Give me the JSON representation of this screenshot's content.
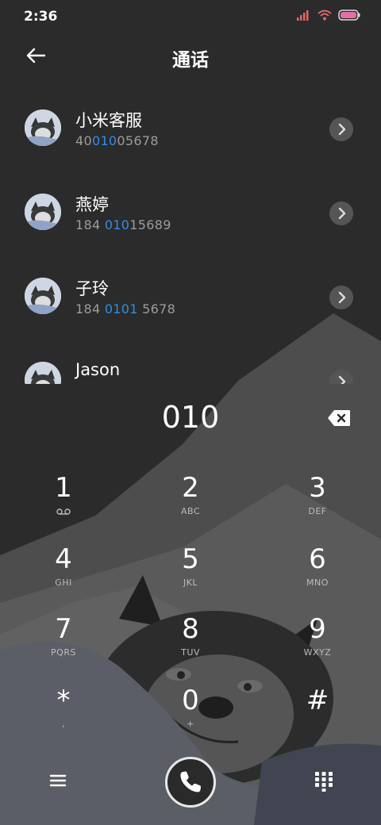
{
  "status_bar": {
    "time": "2:36"
  },
  "header": {
    "title": "通话"
  },
  "contacts": [
    {
      "name": "小米客服",
      "num_pre": "40",
      "num_hl": "010",
      "num_post": "05678"
    },
    {
      "name": "燕婷",
      "num_pre": "184 ",
      "num_hl": "010",
      "num_post": "15689"
    },
    {
      "name": "子玲",
      "num_pre": "184 ",
      "num_hl": "0101",
      "num_post": " 5678"
    },
    {
      "name": "Jason",
      "num_pre": "",
      "num_hl": "",
      "num_post": ""
    }
  ],
  "dialer": {
    "input": "010",
    "keys": [
      {
        "num": "1",
        "sub": ""
      },
      {
        "num": "2",
        "sub": "ABC"
      },
      {
        "num": "3",
        "sub": "DEF"
      },
      {
        "num": "4",
        "sub": "GHI"
      },
      {
        "num": "5",
        "sub": "JKL"
      },
      {
        "num": "6",
        "sub": "MNO"
      },
      {
        "num": "7",
        "sub": "PQRS"
      },
      {
        "num": "8",
        "sub": "TUV"
      },
      {
        "num": "9",
        "sub": "WXYZ"
      },
      {
        "num": "*",
        "sub": ","
      },
      {
        "num": "0",
        "sub": "+"
      },
      {
        "num": "#",
        "sub": ""
      }
    ]
  },
  "colors": {
    "background": "#2b2b2b",
    "highlight": "#2f8ee6",
    "accent": "#e8e8e8"
  },
  "icons": [
    "back-arrow-icon",
    "signal-icon",
    "wifi-icon",
    "battery-icon",
    "chevron-right-icon",
    "backspace-icon",
    "voicemail-icon",
    "menu-icon",
    "phone-icon",
    "dialpad-icon"
  ]
}
